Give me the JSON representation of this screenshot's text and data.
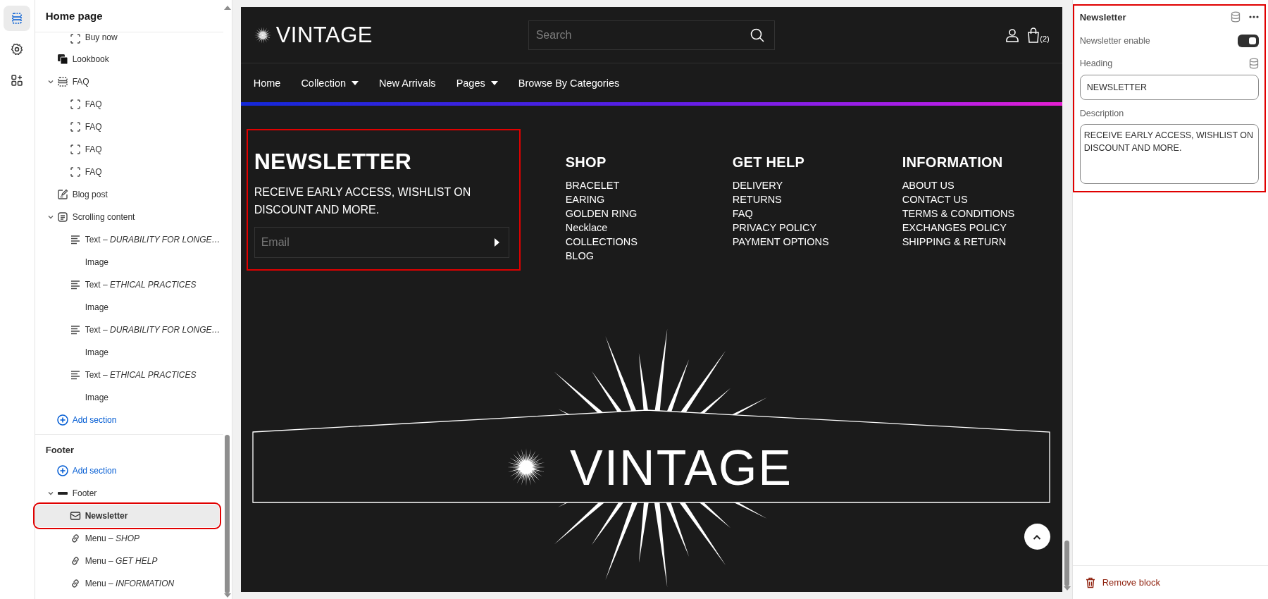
{
  "rail": [
    {
      "kind": "sections",
      "selected": true
    },
    {
      "kind": "settings",
      "selected": false
    },
    {
      "kind": "apps",
      "selected": false
    }
  ],
  "sidebar": {
    "title": "Home page",
    "groups": [
      {
        "items": [
          {
            "children": [
              {
                "kind": "block",
                "label": "Buy now",
                "selected": false
              }
            ]
          },
          {
            "kind": "lookbook",
            "label": "Lookbook",
            "selected": false
          },
          {
            "kind": "section",
            "label": "FAQ",
            "selected": false,
            "expanded": true,
            "children": [
              {
                "kind": "block",
                "label": "FAQ",
                "selected": false
              },
              {
                "kind": "block",
                "label": "FAQ",
                "selected": false
              },
              {
                "kind": "block",
                "label": "FAQ",
                "selected": false
              },
              {
                "kind": "block",
                "label": "FAQ",
                "selected": false
              }
            ]
          },
          {
            "kind": "blog",
            "label": "Blog post",
            "selected": false
          },
          {
            "kind": "scrolling",
            "label": "Scrolling content",
            "selected": false,
            "expanded": true,
            "children": [
              {
                "kind": "text",
                "label": "Text – *DURABILITY FOR LONGE…*",
                "selected": false
              },
              {
                "kind": "image",
                "label": "Image",
                "selected": false
              },
              {
                "kind": "text",
                "label": "Text – *ETHICAL PRACTICES*",
                "selected": false
              },
              {
                "kind": "image",
                "label": "Image",
                "selected": false
              },
              {
                "kind": "text",
                "label": "Text – *DURABILITY FOR LONGE…*",
                "selected": false
              },
              {
                "kind": "image",
                "label": "Image",
                "selected": false
              },
              {
                "kind": "text",
                "label": "Text – *ETHICAL PRACTICES*",
                "selected": false
              },
              {
                "kind": "image",
                "label": "Image",
                "selected": false
              }
            ]
          },
          {
            "kind": "add",
            "label": "Add section",
            "selected": false
          }
        ]
      },
      {
        "title": "Footer",
        "items": [
          {
            "kind": "add",
            "label": "Add section",
            "selected": false
          },
          {
            "kind": "footer",
            "label": "Footer",
            "selected": false,
            "expanded": true,
            "children": [
              {
                "kind": "email",
                "label": "Newsletter",
                "selected": true,
                "highlighted": true
              },
              {
                "kind": "link",
                "label": "Menu – *SHOP*",
                "selected": false
              },
              {
                "kind": "link",
                "label": "Menu – *GET HELP*",
                "selected": false
              },
              {
                "kind": "link",
                "label": "Menu – *INFORMATION*",
                "selected": false
              }
            ]
          }
        ]
      }
    ]
  },
  "preview": {
    "logo": "VINTAGE",
    "search": {
      "placeholder": "Search"
    },
    "cart_count": "(2)",
    "nav": [
      {
        "label": "Home",
        "dropdown": false
      },
      {
        "label": "Collection",
        "dropdown": true
      },
      {
        "label": "New Arrivals",
        "dropdown": false
      },
      {
        "label": "Pages",
        "dropdown": true
      },
      {
        "label": "Browse By Categories",
        "dropdown": false
      }
    ],
    "newsletter": {
      "heading": "NEWSLETTER",
      "description": "RECEIVE EARLY ACCESS, WISHLIST ON DISCOUNT AND MORE.",
      "email_placeholder": "Email",
      "highlighted": true
    },
    "menus": [
      {
        "title": "SHOP",
        "links": [
          "BRACELET",
          "EARING",
          "GOLDEN RING",
          "Necklace",
          "COLLECTIONS",
          "BLOG"
        ]
      },
      {
        "title": "GET HELP",
        "links": [
          "DELIVERY",
          "RETURNS",
          "FAQ",
          "PRIVACY POLICY",
          "PAYMENT OPTIONS"
        ]
      },
      {
        "title": "INFORMATION",
        "links": [
          "ABOUT US",
          "CONTACT US",
          "TERMS & CONDITIONS",
          "EXCHANGES POLICY",
          "SHIPPING & RETURN"
        ]
      }
    ],
    "big_logo": "VINTAGE"
  },
  "panel": {
    "title": "Newsletter",
    "highlighted": true,
    "settings": [
      {
        "kind": "toggle",
        "label": "Newsletter enable",
        "on": true
      },
      {
        "kind": "text",
        "label": "Heading",
        "value": "NEWSLETTER"
      },
      {
        "kind": "textarea",
        "label": "Description",
        "value": "RECEIVE EARLY ACCESS, WISHLIST ON DISCOUNT AND MORE."
      }
    ],
    "remove": "Remove block"
  }
}
